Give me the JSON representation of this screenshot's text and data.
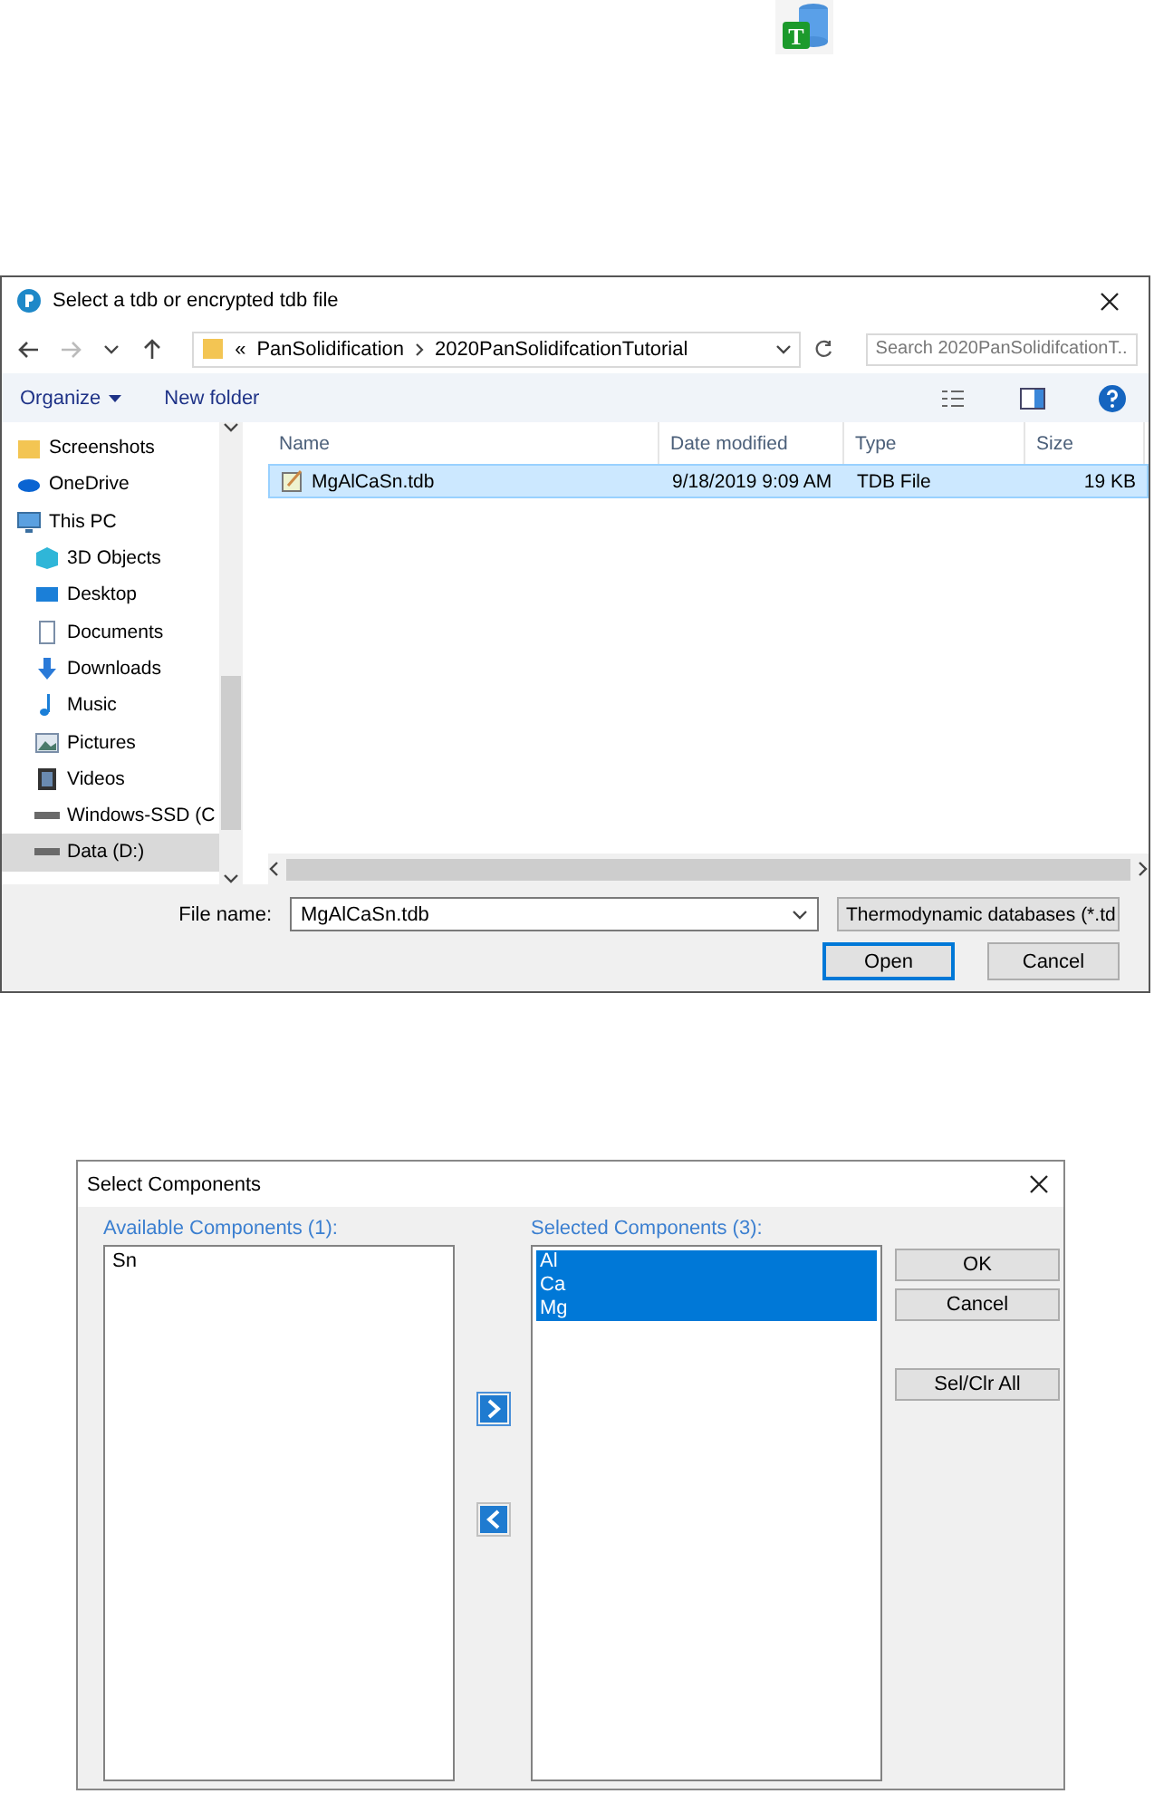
{
  "app_icon": {
    "letter": "T"
  },
  "file_dialog": {
    "title": "Select a tdb or encrypted tdb file",
    "breadcrumb": [
      {
        "label": "«"
      },
      {
        "label": "PanSolidification"
      },
      {
        "label": "2020PanSolidifcationTutorial"
      }
    ],
    "search": {
      "placeholder": "Search 2020PanSolidifcationT..."
    },
    "toolbar": [
      "Organize",
      "New folder"
    ],
    "sidebar": {
      "items": [
        {
          "label": "Screenshots",
          "kind": "folder",
          "selected": false
        },
        {
          "label": "OneDrive",
          "kind": "cloud",
          "selected": false
        },
        {
          "label": "This PC",
          "kind": "pc",
          "selected": false,
          "children": [
            {
              "label": "3D Objects",
              "kind": "cube",
              "selected": false
            },
            {
              "label": "Desktop",
              "kind": "desktop",
              "selected": false
            },
            {
              "label": "Documents",
              "kind": "document",
              "selected": false
            },
            {
              "label": "Downloads",
              "kind": "download",
              "selected": false
            },
            {
              "label": "Music",
              "kind": "music",
              "selected": false
            },
            {
              "label": "Pictures",
              "kind": "picture",
              "selected": false
            },
            {
              "label": "Videos",
              "kind": "video",
              "selected": false
            },
            {
              "label": "Windows-SSD (C",
              "kind": "drive",
              "selected": false
            },
            {
              "label": "Data (D:)",
              "kind": "drive",
              "selected": true
            }
          ]
        }
      ]
    },
    "table": {
      "columns": [
        "Name",
        "Date modified",
        "Type",
        "Size"
      ],
      "rows": [
        {
          "name": "MgAlCaSn.tdb",
          "date": "9/18/2019 9:09 AM",
          "type": "TDB File",
          "size": "19 KB",
          "selected": true
        }
      ]
    },
    "file_name_label": "File name:",
    "file_name": "MgAlCaSn.tdb",
    "file_type": "Thermodynamic databases (*.td",
    "buttons": [
      "Open",
      "Cancel"
    ]
  },
  "components_dialog": {
    "title": "Select Components",
    "available": {
      "label": "Available Components (1):",
      "items": [
        {
          "label": "Sn",
          "selected": false
        }
      ]
    },
    "selected": {
      "label": "Selected Components (3):",
      "items": [
        {
          "label": "Al",
          "selected": true
        },
        {
          "label": "Ca",
          "selected": true
        },
        {
          "label": "Mg",
          "selected": true
        }
      ]
    },
    "buttons": [
      "OK",
      "Cancel",
      "Sel/Clr All"
    ]
  }
}
